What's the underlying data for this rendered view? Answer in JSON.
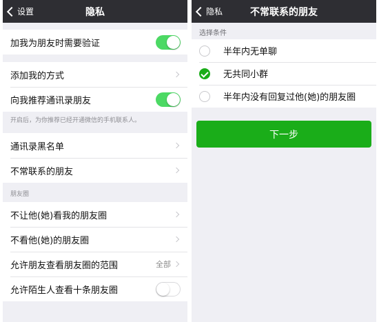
{
  "left": {
    "back_label": "设置",
    "title": "隐私",
    "rows": {
      "add_friend_verify": "加我为朋友时需要验证",
      "add_me_method": "添加我的方式",
      "recommend_contacts": "向我推荐通讯录朋友",
      "contacts_blacklist": "通讯录黑名单",
      "inactive_friends": "不常联系的朋友",
      "not_let_see": "不让他(她)看我的朋友圈",
      "not_see": "不看他(她)的朋友圈",
      "allow_range": "允许朋友查看朋友圈的范围",
      "allow_range_value": "全部",
      "allow_stranger": "允许陌生人查看十条朋友圈"
    },
    "note": "开启后，为你推荐已经开通微信的手机联系人。",
    "moments_header": "朋友圈",
    "toggles": {
      "add_friend_verify": true,
      "recommend_contacts": true,
      "allow_stranger": false
    }
  },
  "right": {
    "back_label": "隐私",
    "title": "不常联系的朋友",
    "section_header": "选择条件",
    "options": [
      {
        "label": "半年内无单聊",
        "checked": false
      },
      {
        "label": "无共同小群",
        "checked": true
      },
      {
        "label": "半年内没有回复过他(她)的朋友圈",
        "checked": false
      }
    ],
    "next_button": "下一步"
  },
  "colors": {
    "navbar": "#2e2e33",
    "toggle_on": "#4cd964",
    "accent_green": "#1aad19",
    "background": "#efeff4"
  },
  "icons": [
    "chevron-left-icon",
    "chevron-right-icon",
    "checkmark-icon"
  ]
}
